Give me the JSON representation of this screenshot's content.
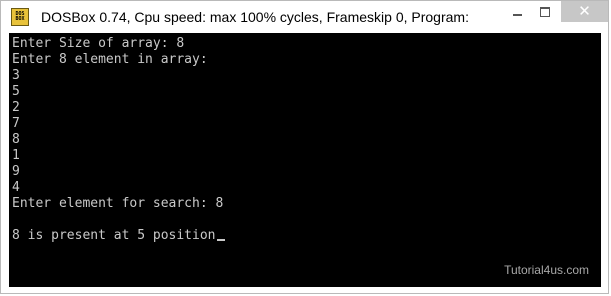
{
  "window": {
    "title": "DOSBox 0.74, Cpu speed: max 100% cycles, Frameskip  0, Program:",
    "icon_text": [
      "DOS",
      "BOX"
    ],
    "controls": {
      "minimize": "minimize-icon",
      "maximize": "maximize-icon",
      "close": "close-icon",
      "close_glyph": "✕"
    }
  },
  "console": {
    "lines": [
      "Enter Size of array: 8",
      "Enter 8 element in array:",
      "3",
      "5",
      "2",
      "7",
      "8",
      "1",
      "9",
      "4",
      "Enter element for search: 8",
      "",
      "8 is present at 5 position"
    ],
    "watermark": "Tutorial4us.com"
  },
  "colors": {
    "console_bg": "#000000",
    "console_text": "#c9c9c9",
    "close_button": "#c7c7c7",
    "watermark": "#a8a8a8"
  }
}
